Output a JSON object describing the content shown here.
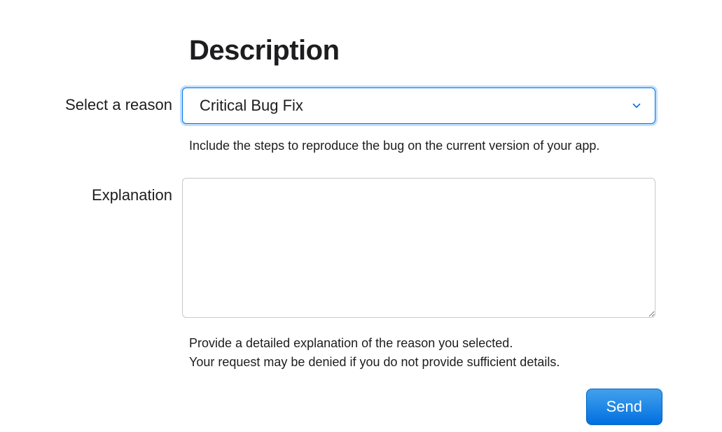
{
  "heading": "Description",
  "reason": {
    "label": "Select a reason",
    "selected": "Critical Bug Fix",
    "helper": "Include the steps to reproduce the bug on the current version of your app."
  },
  "explanation": {
    "label": "Explanation",
    "value": "",
    "helper_line1": "Provide a detailed explanation of the reason you selected.",
    "helper_line2": "Your request may be denied if you do not provide sufficient details."
  },
  "send_button": "Send"
}
